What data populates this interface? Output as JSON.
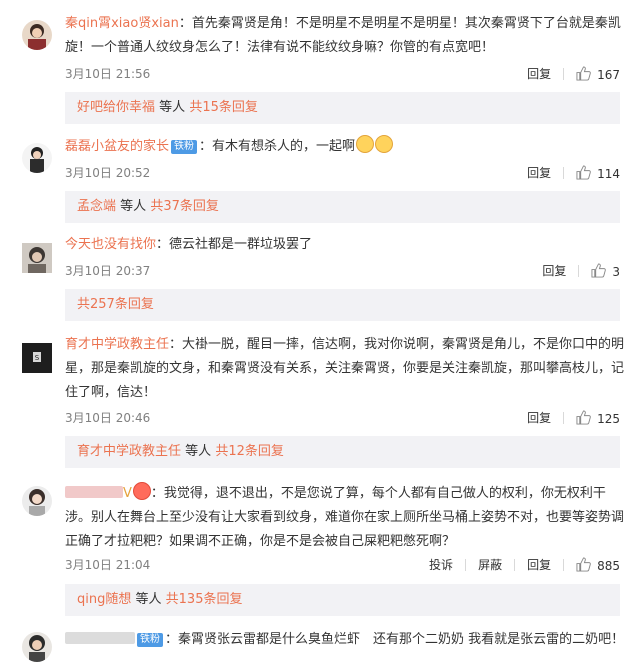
{
  "comments": [
    {
      "user": "秦qin霄xiao贤xian",
      "text": "：首先秦霄贤是角！不是明星不是明星不是明星！其次秦霄贤下了台就是秦凯旋！一个普通人纹纹身怎么了！法律有说不能纹纹身嘛？你管的有点宽吧！",
      "time": "3月10日 21:56",
      "reply_label": "回复",
      "likes": "167",
      "replies": {
        "user": "好吧给你幸福",
        "mid": "等人",
        "count": "共15条回复"
      }
    },
    {
      "user": "磊磊小盆友的家长",
      "badge": "铁粉",
      "text": "：有木有想杀人的，一起啊",
      "time": "3月10日 20:52",
      "reply_label": "回复",
      "likes": "114",
      "replies": {
        "user": "孟念端",
        "mid": "等人",
        "count": "共37条回复"
      }
    },
    {
      "user": "今天也没有找你",
      "text": "：德云社都是一群垃圾罢了",
      "time": "3月10日 20:37",
      "reply_label": "回复",
      "likes": "3",
      "replies": {
        "count": "共257条回复"
      }
    },
    {
      "user": "育才中学政教主任",
      "text": "：大褂一脱，醒目一摔，信达啊，我对你说啊，秦霄贤是角儿，不是你口中的明星，那是秦凯旋的文身，和秦霄贤没有关系，关注秦霄贤，你要是关注秦凯旋，那叫攀高枝儿，记住了啊，信达！",
      "time": "3月10日 20:46",
      "reply_label": "回复",
      "likes": "125",
      "replies": {
        "user": "育才中学政教主任",
        "mid": "等人",
        "count": "共12条回复"
      }
    },
    {
      "user": "",
      "text": "：我觉得，退不退出，不是您说了算，每个人都有自己做人的权利，你无权利干涉。别人在舞台上至少没有让大家看到纹身，难道你在家上厕所坐马桶上姿势不对，也要等姿势调正确了才拉粑粑？如果调不正确，你是不是会被自己屎粑粑憋死啊？",
      "time": "3月10日 21:04",
      "report_label": "投诉",
      "block_label": "屏蔽",
      "reply_label": "回复",
      "likes": "885",
      "replies": {
        "user": "qing随想",
        "mid": "等人",
        "count": "共135条回复"
      }
    },
    {
      "user": "",
      "badge": "铁粉",
      "text": "：秦霄贤张云雷都是什么臭鱼烂虾　还有那个二奶奶 我看就是张云雷的二奶吧！"
    }
  ]
}
